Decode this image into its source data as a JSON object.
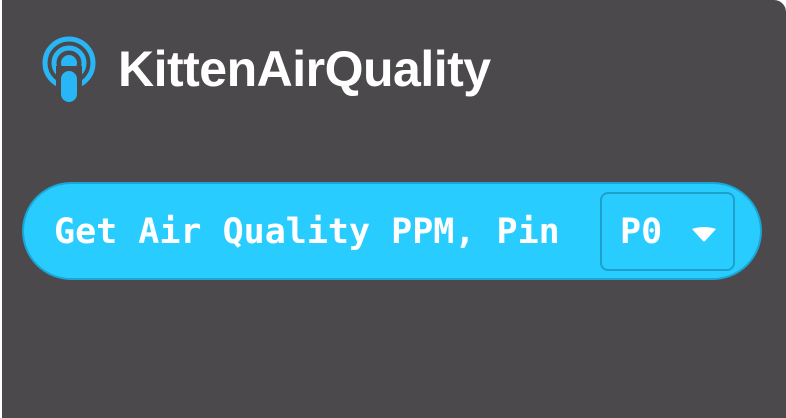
{
  "extension": {
    "title": "KittenAirQuality",
    "icon": "podcast-broadcast-icon",
    "accent_color": "#29ccff"
  },
  "block": {
    "label": "Get Air Quality PPM, Pin",
    "pin_dropdown": {
      "selected": "P0",
      "icon": "caret-down-icon"
    }
  },
  "colors": {
    "background": "#4b494b",
    "block_fill": "#29ccff",
    "block_border": "#1aa6d6",
    "text": "#ffffff"
  }
}
